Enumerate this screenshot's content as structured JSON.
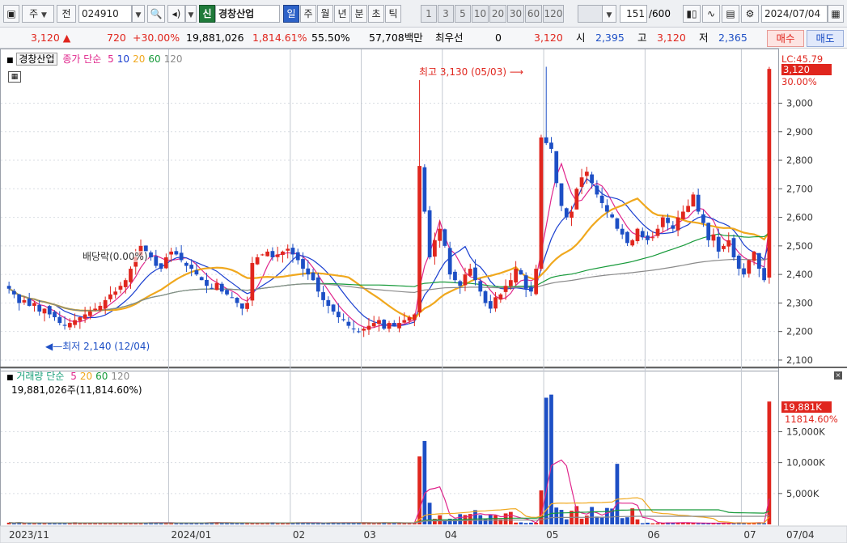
{
  "toolbar": {
    "market_type": "주",
    "prev_label": "전",
    "stock_code": "024910",
    "credit_badge": "신",
    "stock_name": "경창산업",
    "periods": [
      "일",
      "주",
      "월",
      "년",
      "분",
      "초",
      "틱"
    ],
    "active_period": "일",
    "intervals": [
      "1",
      "3",
      "5",
      "10",
      "20",
      "30",
      "60",
      "120"
    ],
    "count": "151",
    "total": "/600",
    "date": "2024/07/04"
  },
  "quote": {
    "price": "3,120",
    "change": "720",
    "change_pct": "+30.00%",
    "volume": "19,881,026",
    "volume_ratio": "1,814.61%",
    "turnover": "55.50%",
    "amount": "57,708백만",
    "pref_label": "최우선",
    "pref_value": "0",
    "ask_price": "3,120",
    "open_label": "시",
    "open": "2,395",
    "high_label": "고",
    "high": "3,120",
    "low_label": "저",
    "low": "2,365",
    "buy_button": "매수",
    "sell_button": "매도"
  },
  "price_panel": {
    "stock_name": "경창산업",
    "ma_label": "종가 단순",
    "ma_periods": [
      "5",
      "10",
      "20",
      "60",
      "120"
    ],
    "ma_colors": [
      "#e0268c",
      "#1a3fd0",
      "#f0a81e",
      "#179a3a",
      "#8a8a8a"
    ],
    "dividend_note": "배당락(0.00%)",
    "high_annotation": "최고 3,130 (05/03)",
    "low_annotation": "최저 2,140 (12/04)",
    "lc_label": "LC:45.79",
    "current_price_tag": "3,120",
    "change_tag": "30.00%",
    "y_labels": [
      "3,000",
      "2,900",
      "2,800",
      "2,700",
      "2,600",
      "2,500",
      "2,400",
      "2,300",
      "2,200",
      "2,100"
    ]
  },
  "volume_panel": {
    "title": "거래량 단순",
    "ma_periods": [
      "5",
      "20",
      "60",
      "120"
    ],
    "current_volume": "19,881,026주(11,814.60%)",
    "volume_tag": "19,881K",
    "ratio_tag": "11814.60%",
    "y_labels": [
      "15,000K",
      "10,000K",
      "5,000K"
    ]
  },
  "x_axis": {
    "labels": [
      "2023/11",
      "2024/01",
      "02",
      "03",
      "04",
      "05",
      "06",
      "07",
      "07/04"
    ]
  },
  "chart_data": {
    "type": "candlestick",
    "ylim": [
      2080,
      3180
    ],
    "volume_ylim": [
      0,
      22000
    ],
    "bull_color": "#e0261e",
    "bear_color": "#1d4fc5",
    "candles": []
  }
}
